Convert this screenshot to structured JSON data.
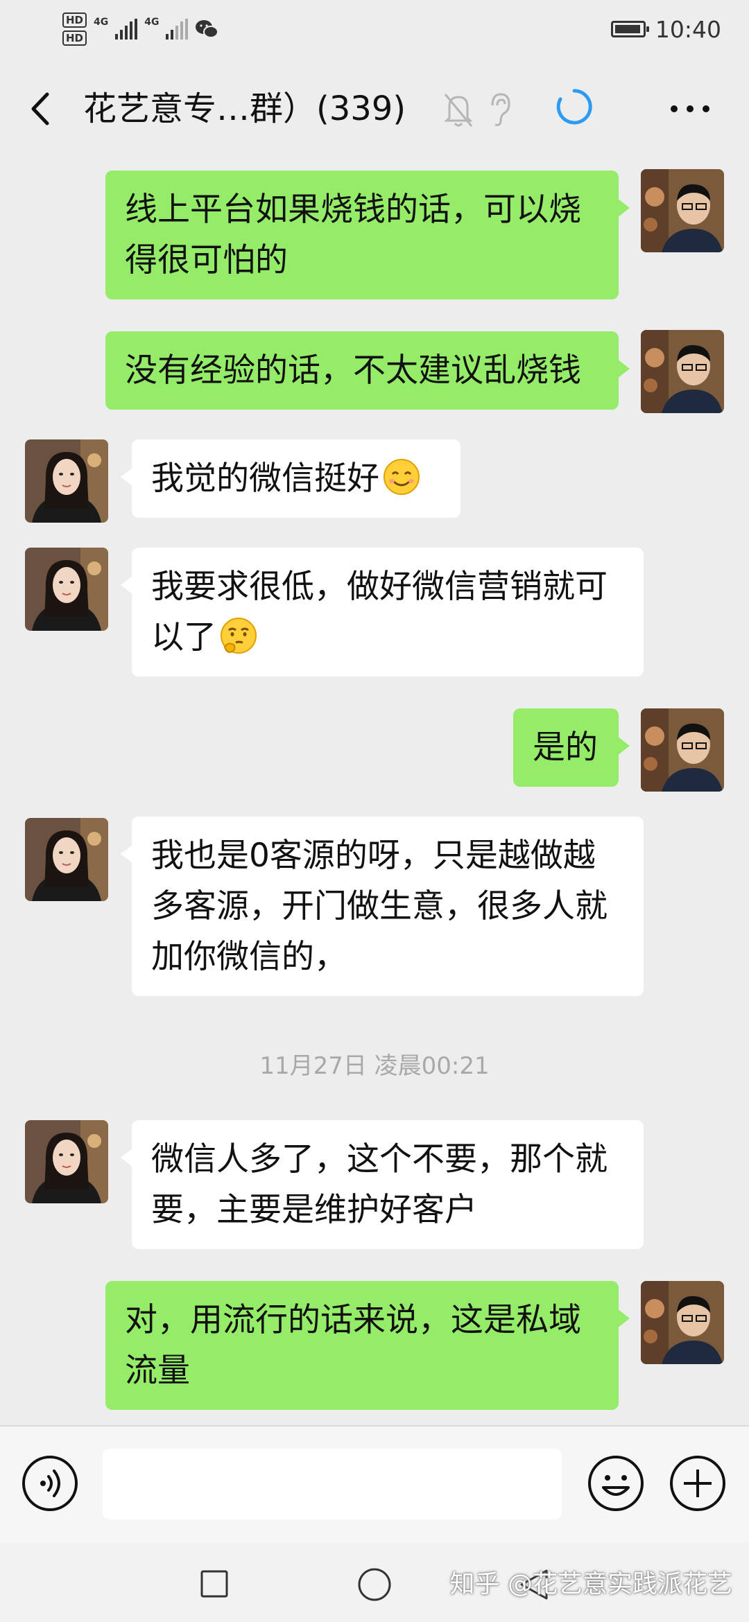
{
  "status_bar": {
    "hd1": "HD",
    "hd2": "HD",
    "net1": "4G",
    "net2": "4G",
    "time": "10:40"
  },
  "header": {
    "title": "花艺意专…群）(339)"
  },
  "messages": [
    {
      "side": "right",
      "text": "线上平台如果烧钱的话，可以烧得很可怕的"
    },
    {
      "side": "right",
      "text": "没有经验的话，不太建议乱烧钱"
    },
    {
      "side": "left",
      "text": "我觉的微信挺好",
      "emoji": "smile-emoji"
    },
    {
      "side": "left",
      "text": "我要求很低，做好微信营销就可以了",
      "emoji": "thinking-emoji"
    },
    {
      "side": "right",
      "text": "是的"
    },
    {
      "side": "left",
      "text": "我也是0客源的呀，只是越做越多客源，开门做生意，很多人就加你微信的，"
    },
    {
      "side": "left",
      "text": "微信人多了，这个不要，那个就要，主要是维护好客户"
    },
    {
      "side": "right",
      "text": "对，用流行的话来说，这是私域流量"
    }
  ],
  "timestamp": "11月27日 凌晨00:21",
  "input": {
    "value": ""
  },
  "watermark": "知乎 @花艺意实践派花艺",
  "colors": {
    "background": "#ededed",
    "green_bubble": "#95ec69",
    "white_bubble": "#ffffff",
    "loading_blue": "#2b9bf4"
  }
}
